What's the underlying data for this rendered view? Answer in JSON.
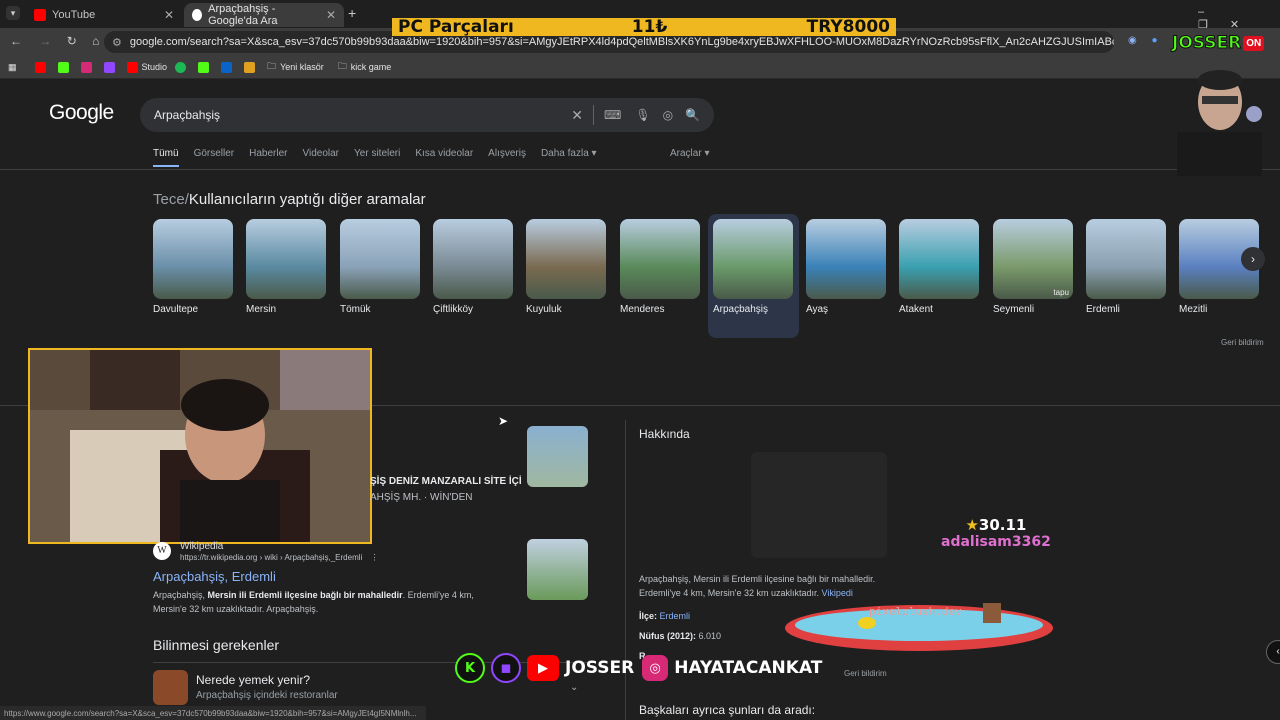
{
  "browser": {
    "tabs": [
      {
        "title": "YouTube",
        "close": "✕"
      },
      {
        "title": "Arpaçbahşiş - Google'da Ara",
        "close": "✕"
      }
    ],
    "new_tab": "+",
    "url": "google.com/search?sa=X&sca_esv=37dc570b99b93daa&biw=1920&bih=957&si=AMgyJEtRPX4ld4pdQeltMBlsXK6YnLg9be4xryEBJwXFHLOO-MUOxM8DazRYrNOzRcb95sFflX_An2cAHZGJUSImIABcka55SJPsMIRX-FjLuhxoG0mtTodco...",
    "bookmarks": [
      "Studio",
      "Yeni klasör",
      "kick game"
    ],
    "status_url": "https://www.google.com/search?sa=X&sca_esv=37dc570b99b93daa&biw=1920&bih=957&si=AMgyJEt4gI5NMlnlh..."
  },
  "overlay": {
    "banner_label": "PC Parçaları",
    "banner_mid": "11₺",
    "banner_goal": "TRY8000",
    "brand": "JOSSER",
    "brand_on": "ON",
    "donor_amount": "30.11",
    "donor_name": "adalisam3362",
    "pool_text": "pixelplush.dev",
    "social_handle": "JOSSER",
    "instagram_handle": "HAYATACANKAT"
  },
  "google": {
    "logo": "Google",
    "query": "Arpaçbahşiş",
    "nav_tabs": [
      "Tümü",
      "Görseller",
      "Haberler",
      "Videolar",
      "Yer siteleri",
      "Kısa videolar",
      "Alışveriş",
      "Daha fazla ▾"
    ],
    "tools": "Araçlar ▾",
    "related_prefix": "Tece",
    "related_title": "Kullanıcıların yaptığı diğer aramalar",
    "related": [
      {
        "label": "Davultepe",
        "color": "#6a8fa8"
      },
      {
        "label": "Mersin",
        "color": "#5a8aa0"
      },
      {
        "label": "Tömük",
        "color": "#8aa2b8"
      },
      {
        "label": "Çiftlikköy",
        "color": "#7a8a94"
      },
      {
        "label": "Kuyuluk",
        "color": "#7a6a50"
      },
      {
        "label": "Menderes",
        "color": "#5a8a5a"
      },
      {
        "label": "Arpaçbahşiş",
        "color": "#6a9a6a"
      },
      {
        "label": "Ayaş",
        "color": "#3a82b8"
      },
      {
        "label": "Atakent",
        "color": "#3aa0b0"
      },
      {
        "label": "Seymenli",
        "color": "#7a9a6a"
      },
      {
        "label": "Erdemli",
        "color": "#8aa0b0"
      },
      {
        "label": "Mezitli",
        "color": "#5a80c0"
      }
    ],
    "thumb_watermark": "tapu",
    "feedback": "Geri bildirim",
    "result1_snippet_a": "ŞİŞ DENİZ MANZARALI SİTE İÇİ",
    "result1_snippet_b": "AHŞİŞ MH. · WİN'DEN",
    "wiki_site": "Wikipedia",
    "wiki_url": "https://tr.wikipedia.org › wiki › Arpaçbahşiş,_Erdemli",
    "wiki_menu": "⋮",
    "wiki_title": "Arpaçbahşiş, Erdemli",
    "wiki_snippet_1": "Arpaçbahşiş, ",
    "wiki_snippet_bold": "Mersin ili Erdemli ilçesine bağlı bir mahalledir",
    "wiki_snippet_2": ". Erdemli'ye 4 km, Mersin'e 32 km uzaklıktadır. Arpaçbahşiş.",
    "knowbox_heading": "Bilinmesi gerekenler",
    "knowbox_q": "Nerede yemek yenir?",
    "knowbox_a": "Arpaçbahşiş içindeki restoranlar",
    "about_heading": "Hakkında",
    "about_text": "Arpaçbahşiş, Mersin ili Erdemli ilçesine bağlı bir mahalledir. Erdemli'ye 4 km, Mersin'e 32 km uzaklıktadır.",
    "about_source": "Vikipedi",
    "ilce_label": "İlçe:",
    "ilce_value": "Erdemli",
    "nufus_label": "Nüfus (2012):",
    "nufus_value": "6.010",
    "cut_label": "R",
    "about_feedback": "Geri bildirim",
    "also_searched": "Başkaları ayrıca şunları da aradı:"
  }
}
